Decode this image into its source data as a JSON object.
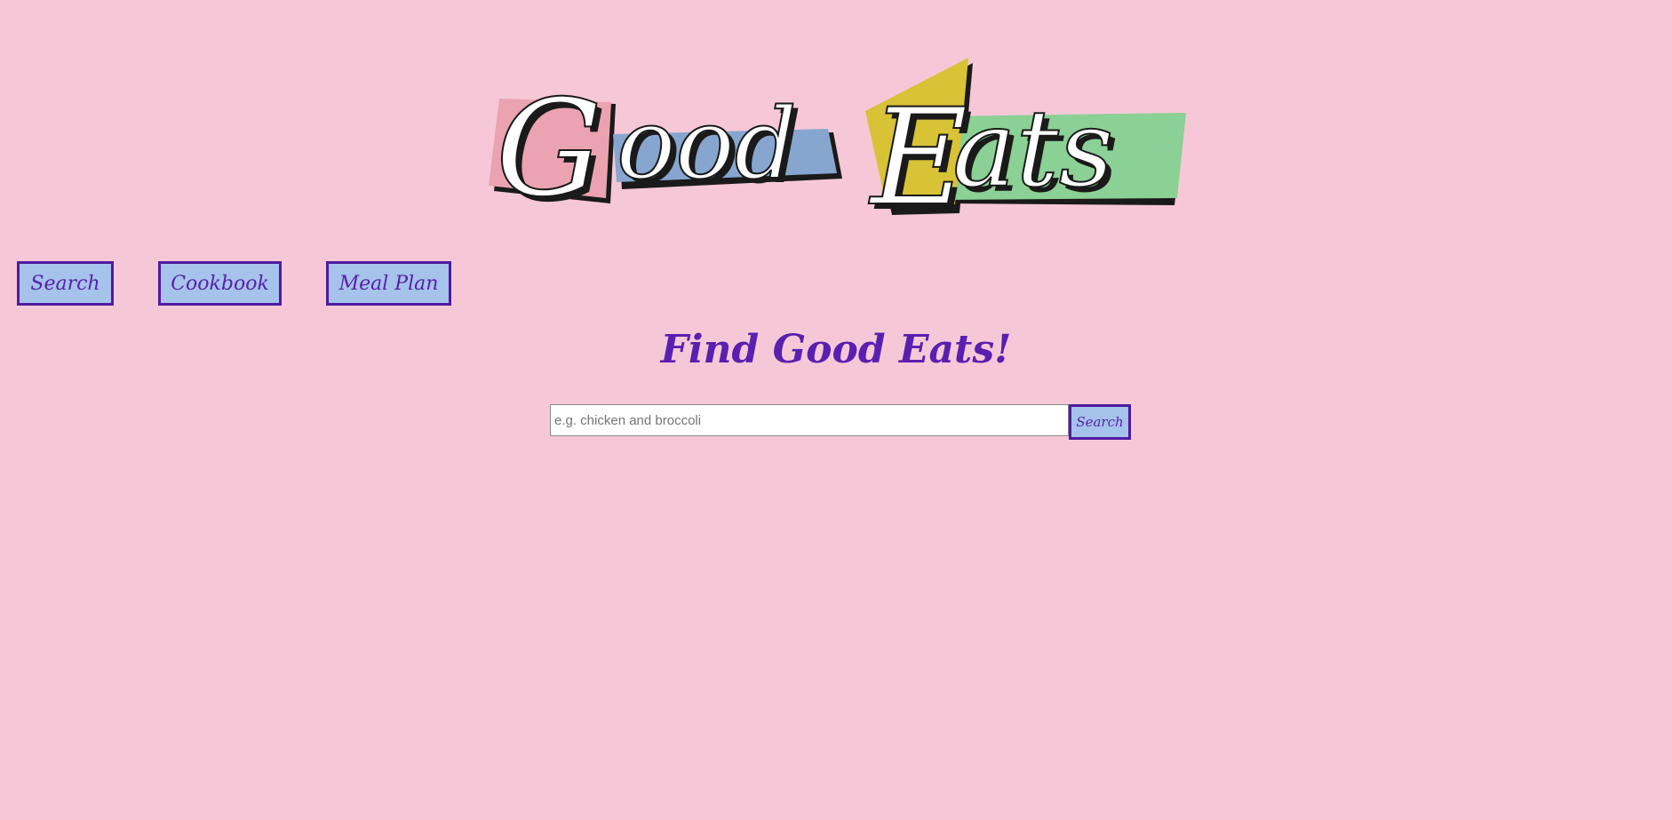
{
  "logo": {
    "title": "Good Eats",
    "letters": [
      "G",
      "ood",
      "E",
      "ats"
    ],
    "colors": {
      "pink_block": "#eba2b1",
      "blue_block": "#86a6cf",
      "yellow_block": "#d8c236",
      "green_block": "#8bd094",
      "shadow": "#1a1a1a",
      "letter_fill": "#ffffff"
    }
  },
  "nav": {
    "items": [
      {
        "label": "Search"
      },
      {
        "label": "Cookbook"
      },
      {
        "label": "Meal Plan"
      }
    ]
  },
  "main": {
    "title": "Find Good Eats!",
    "search": {
      "placeholder": "e.g. chicken and broccoli",
      "value": "",
      "button_label": "Search"
    }
  },
  "theme": {
    "background": "#f6c8d7",
    "button_bg": "#a5c3eb",
    "button_border": "#4f1aa0",
    "accent_text": "#5a1fb0"
  }
}
